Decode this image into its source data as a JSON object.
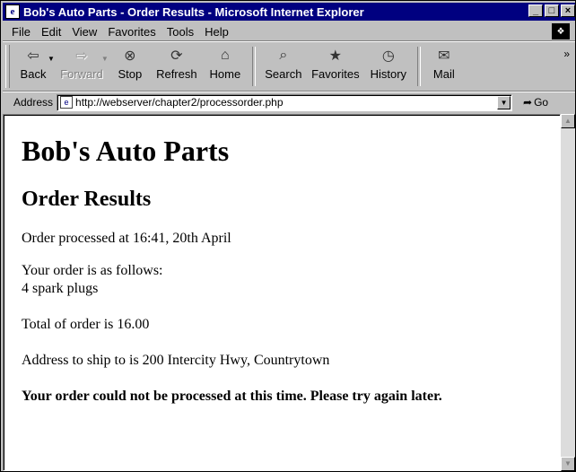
{
  "window": {
    "title": "Bob's Auto Parts - Order Results - Microsoft Internet Explorer",
    "controls": {
      "minimize": "_",
      "maximize": "□",
      "close": "×"
    }
  },
  "menu": {
    "items": [
      "File",
      "Edit",
      "View",
      "Favorites",
      "Tools",
      "Help"
    ]
  },
  "toolbar": {
    "buttons": [
      {
        "label": "Back",
        "icon": "back-arrow-icon",
        "glyph": "⇦",
        "enabled": true,
        "dropdown": true
      },
      {
        "label": "Forward",
        "icon": "forward-arrow-icon",
        "glyph": "⇨",
        "enabled": false,
        "dropdown": true
      },
      {
        "label": "Stop",
        "icon": "stop-icon",
        "glyph": "⊗",
        "enabled": true
      },
      {
        "label": "Refresh",
        "icon": "refresh-icon",
        "glyph": "⟳",
        "enabled": true
      },
      {
        "label": "Home",
        "icon": "home-icon",
        "glyph": "⌂",
        "enabled": true
      },
      {
        "label": "Search",
        "icon": "search-icon",
        "glyph": "⌕",
        "enabled": true
      },
      {
        "label": "Favorites",
        "icon": "favorites-icon",
        "glyph": "★",
        "enabled": true
      },
      {
        "label": "History",
        "icon": "history-icon",
        "glyph": "◷",
        "enabled": true
      },
      {
        "label": "Mail",
        "icon": "mail-icon",
        "glyph": "✉",
        "enabled": true,
        "dropdown": true
      }
    ],
    "more_glyph": "»"
  },
  "address": {
    "label": "Address",
    "url": "http://webserver/chapter2/processorder.php",
    "go_label": "Go"
  },
  "page": {
    "heading": "Bob's Auto Parts",
    "subheading": "Order Results",
    "processed_line": "Order processed at 16:41, 20th April",
    "order_intro": "Your order is as follows:",
    "order_item": "4 spark plugs",
    "total_line": "Total of order is 16.00",
    "address_line": "Address to ship to is 200 Intercity Hwy, Countrytown",
    "error_message": "Your order could not be processed at this time. Please try again later."
  }
}
